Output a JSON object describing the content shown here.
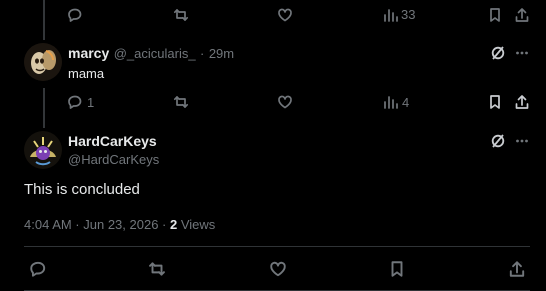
{
  "top_row": {
    "views_count": "33"
  },
  "reply": {
    "name": "marcy",
    "handle": "@_acicularis_",
    "separator": "·",
    "time": "29m",
    "text": "mama",
    "reply_count": "1",
    "views_count": "4"
  },
  "main_post": {
    "name": "HardCarKeys",
    "handle": "@HardCarKeys",
    "text": "This is concluded",
    "timestamp": "4:04 AM · Jun 23, 2026 · ",
    "views_count": "2",
    "views_label": "Views"
  },
  "icons": {
    "reply": "reply-icon",
    "repost": "repost-icon",
    "like": "like-icon",
    "views": "views-icon",
    "bookmark": "bookmark-icon",
    "share": "share-icon",
    "grok": "grok-icon",
    "more": "more-icon"
  },
  "colors": {
    "background": "#000000",
    "text": "#e7e9ea",
    "muted": "#71767b",
    "divider": "#2f3336"
  }
}
